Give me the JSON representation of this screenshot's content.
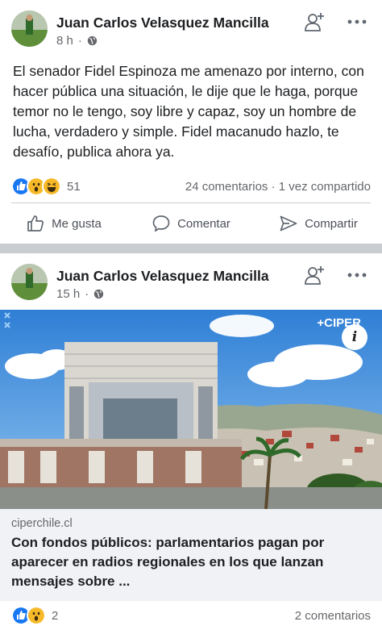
{
  "posts": [
    {
      "author": "Juan Carlos Velasquez Mancilla",
      "time": "8 h",
      "text": "El senador Fidel Espinoza me amenazo por interno, con hacer pública una situación, le dije que le haga, porque temor no le tengo, soy libre y capaz, soy un hombre de lucha, verdadero y simple. Fidel macanudo hazlo, te desafío, publica ahora ya.",
      "reaction_count": "51",
      "comments": "24 comentarios",
      "shares": "1 vez compartido"
    },
    {
      "author": "Juan Carlos Velasquez Mancilla",
      "time": "15 h",
      "image_brand": "+CIPER",
      "info_icon_text": "i",
      "link_domain": "ciperchile.cl",
      "link_title": "Con fondos públicos: parlamentarios pagan por aparecer en radios regionales en los que lanzan mensajes sobre ...",
      "reaction_count": "2",
      "comments": "2 comentarios"
    }
  ],
  "actions": {
    "like": "Me gusta",
    "comment": "Comentar",
    "share": "Compartir"
  },
  "separator_dot": "·",
  "colors": {
    "like_blue": "#1877f2",
    "reaction_yellow": "#f7b928",
    "separator": "#c9ccd1",
    "link_box": "#f0f2f5"
  }
}
